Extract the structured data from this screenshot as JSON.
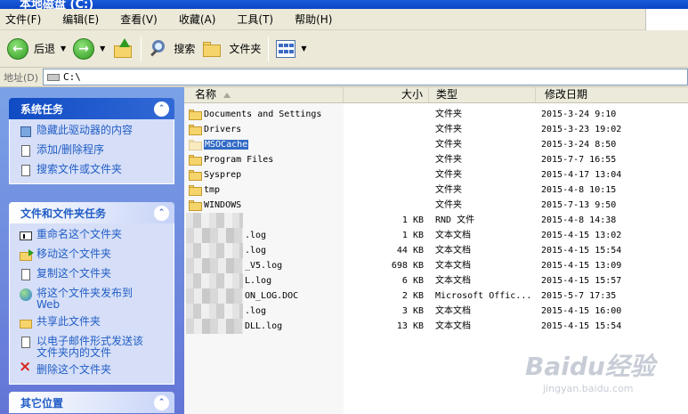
{
  "window": {
    "title": "本地磁盘 (C:)"
  },
  "menu": [
    {
      "label": "文件(F)"
    },
    {
      "label": "编辑(E)"
    },
    {
      "label": "查看(V)"
    },
    {
      "label": "收藏(A)"
    },
    {
      "label": "工具(T)"
    },
    {
      "label": "帮助(H)"
    }
  ],
  "toolbar": {
    "back_label": "后退",
    "search_label": "搜索",
    "folders_label": "文件夹"
  },
  "address": {
    "label": "地址(D)",
    "value": "C:\\"
  },
  "taskpane": {
    "system": {
      "title": "系统任务",
      "items": [
        {
          "label": "隐藏此驱动器的内容",
          "icon": "drive-hide-icon"
        },
        {
          "label": "添加/删除程序",
          "icon": "add-remove-programs-icon"
        },
        {
          "label": "搜索文件或文件夹",
          "icon": "search-icon"
        }
      ]
    },
    "filefolder": {
      "title": "文件和文件夹任务",
      "items": [
        {
          "label": "重命名这个文件夹",
          "icon": "rename-icon"
        },
        {
          "label": "移动这个文件夹",
          "icon": "move-folder-icon"
        },
        {
          "label": "复制这个文件夹",
          "icon": "copy-folder-icon"
        },
        {
          "label": "将这个文件夹发布到",
          "label2": "Web",
          "icon": "publish-web-icon"
        },
        {
          "label": "共享此文件夹",
          "icon": "share-folder-icon"
        },
        {
          "label": "以电子邮件形式发送该",
          "label2": "文件夹内的文件",
          "icon": "email-icon"
        },
        {
          "label": "删除这个文件夹",
          "icon": "delete-icon"
        }
      ]
    },
    "other": {
      "title": "其它位置"
    }
  },
  "columns": {
    "name": "名称",
    "size": "大小",
    "type": "类型",
    "date": "修改日期"
  },
  "files": [
    {
      "name": "Documents and Settings",
      "size": "",
      "type": "文件夹",
      "date": "2015-3-24 9:10",
      "kind": "folder"
    },
    {
      "name": "Drivers",
      "size": "",
      "type": "文件夹",
      "date": "2015-3-23 19:02",
      "kind": "folder"
    },
    {
      "name": "MSOCache",
      "size": "",
      "type": "文件夹",
      "date": "2015-3-24 8:50",
      "kind": "folder-hidden",
      "selected": true
    },
    {
      "name": "Program Files",
      "size": "",
      "type": "文件夹",
      "date": "2015-7-7 16:55",
      "kind": "folder"
    },
    {
      "name": "Sysprep",
      "size": "",
      "type": "文件夹",
      "date": "2015-4-17 13:04",
      "kind": "folder"
    },
    {
      "name": "tmp",
      "size": "",
      "type": "文件夹",
      "date": "2015-4-8 10:15",
      "kind": "folder"
    },
    {
      "name": "WINDOWS",
      "size": "",
      "type": "文件夹",
      "date": "2015-7-13 9:50",
      "kind": "folder"
    },
    {
      "name": "",
      "size": "1 KB",
      "type": "RND 文件",
      "date": "2015-4-8 14:38",
      "kind": "file-blur"
    },
    {
      "name": ".log",
      "size": "1 KB",
      "type": "文本文档",
      "date": "2015-4-15 13:02",
      "kind": "file-blur"
    },
    {
      "name": ".log",
      "size": "44 KB",
      "type": "文本文档",
      "date": "2015-4-15 15:54",
      "kind": "file-blur"
    },
    {
      "name": "_V5.log",
      "size": "698 KB",
      "type": "文本文档",
      "date": "2015-4-15 13:09",
      "kind": "file-blur"
    },
    {
      "name": "L.log",
      "size": "6 KB",
      "type": "文本文档",
      "date": "2015-4-15 15:57",
      "kind": "file-blur"
    },
    {
      "name": "ON_LOG.DOC",
      "size": "2 KB",
      "type": "Microsoft Offic...",
      "date": "2015-5-7 17:35",
      "kind": "file-blur"
    },
    {
      "name": ".log",
      "size": "3 KB",
      "type": "文本文档",
      "date": "2015-4-15 16:00",
      "kind": "file-blur"
    },
    {
      "name": "DLL.log",
      "size": "13 KB",
      "type": "文本文档",
      "date": "2015-4-15 15:54",
      "kind": "file-blur"
    }
  ],
  "watermark": {
    "brand": "Baidu经验",
    "url": "jingyan.baidu.com"
  }
}
